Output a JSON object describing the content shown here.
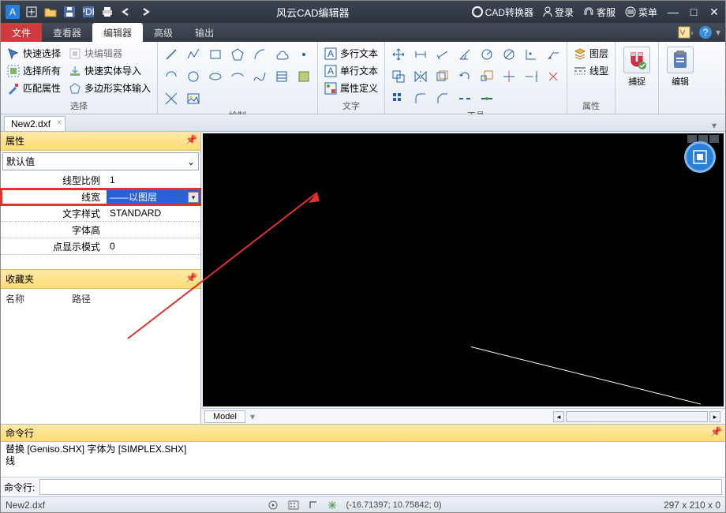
{
  "titlebar": {
    "title": "风云CAD编辑器"
  },
  "titleright": {
    "convert": "CAD转换器",
    "login": "登录",
    "support": "客服",
    "menu": "菜单"
  },
  "menubar": {
    "file": "文件",
    "viewer": "查看器",
    "editor": "编辑器",
    "advanced": "高级",
    "output": "输出"
  },
  "ribbon": {
    "select": {
      "label": "选择",
      "quick": "快速选择",
      "all": "选择所有",
      "match": "匹配属性",
      "blockedit": "块编辑器",
      "solidimport": "快速实体导入",
      "polyinput": "多边形实体输入"
    },
    "draw": {
      "label": "绘制"
    },
    "text": {
      "label": "文字",
      "mtext": "多行文本",
      "stext": "单行文本",
      "attdef": "属性定义"
    },
    "tools": {
      "label": "工具"
    },
    "props": {
      "label": "属性",
      "layer": "图层",
      "ltype": "线型"
    },
    "snap": {
      "label": "捕捉"
    },
    "edit": {
      "label": "编辑"
    }
  },
  "doctab": "New2.dxf",
  "propspanel": {
    "title": "属性",
    "combo": "默认值",
    "rows": {
      "ltscale": {
        "k": "线型比例",
        "v": "1"
      },
      "lweight": {
        "k": "线宽",
        "v": "——以图层"
      },
      "txtstyle": {
        "k": "文字样式",
        "v": "STANDARD"
      },
      "txtheight": {
        "k": "字体高",
        "v": ""
      },
      "ptmode": {
        "k": "点显示模式",
        "v": "0"
      }
    }
  },
  "fav": {
    "title": "收藏夹",
    "col1": "名称",
    "col2": "路径"
  },
  "modeltab": "Model",
  "cmd": {
    "title": "命令行",
    "log1": "替换 [Geniso.SHX] 字体为 [SIMPLEX.SHX]",
    "log2": "线",
    "prompt": "命令行:"
  },
  "status": {
    "file": "New2.dxf",
    "coords": "(-16.71397; 10.75842; 0)",
    "dims": "297 x 210 x 0"
  }
}
